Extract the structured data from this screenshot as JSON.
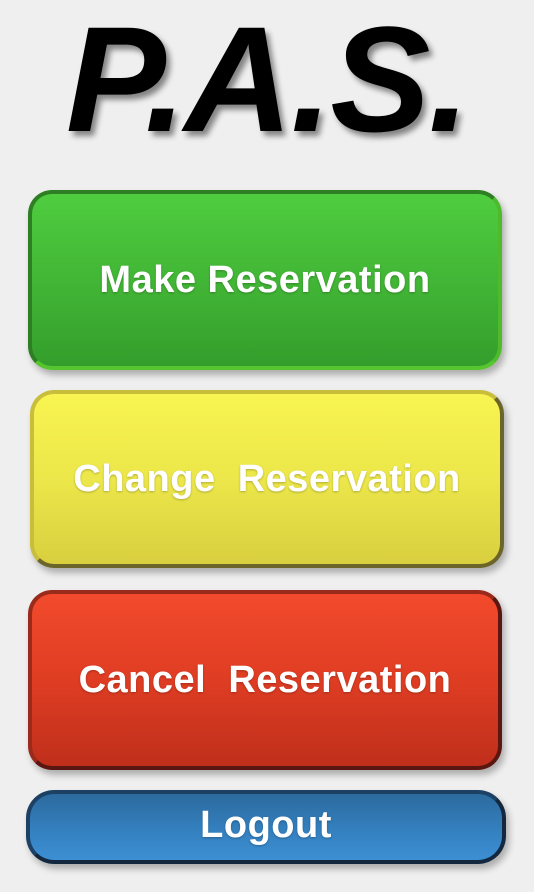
{
  "app": {
    "title": "P.A.S."
  },
  "buttons": {
    "make_reservation": "Make Reservation",
    "change_reservation": "Change  Reservation",
    "cancel_reservation": "Cancel  Reservation",
    "logout": "Logout"
  },
  "colors": {
    "background": "#efefef",
    "make_button": "#42b636",
    "change_button": "#ece74a",
    "cancel_button": "#df3d23",
    "logout_button": "#3480bf",
    "button_text": "#ffffff"
  }
}
